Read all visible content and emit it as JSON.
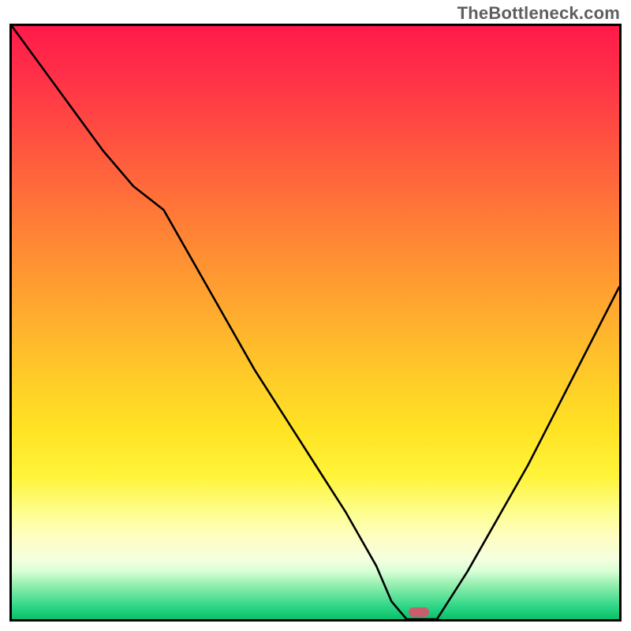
{
  "watermark": "TheBottleneck.com",
  "chart_data": {
    "type": "line",
    "title": "",
    "xlabel": "",
    "ylabel": "",
    "ylim": [
      0,
      100
    ],
    "x": [
      0,
      5,
      10,
      15,
      20,
      25,
      30,
      35,
      40,
      45,
      50,
      55,
      60,
      62.5,
      65,
      67.5,
      70,
      75,
      80,
      85,
      90,
      95,
      100
    ],
    "values": [
      100,
      93,
      86,
      79,
      73,
      69,
      60,
      51,
      42,
      34,
      26,
      18,
      9,
      3,
      0,
      0,
      0,
      8,
      17,
      26,
      36,
      46,
      56
    ],
    "marker_x": 67,
    "background_gradient": {
      "top": "#ff1a4a",
      "upper_mid": "#ffa130",
      "mid": "#ffe324",
      "lower_mid": "#fdfe8f",
      "bottom": "#09c06a"
    }
  },
  "colors": {
    "curve": "#000000",
    "frame": "#000000",
    "marker": "#c75d6d",
    "watermark": "#5e5e5e"
  }
}
